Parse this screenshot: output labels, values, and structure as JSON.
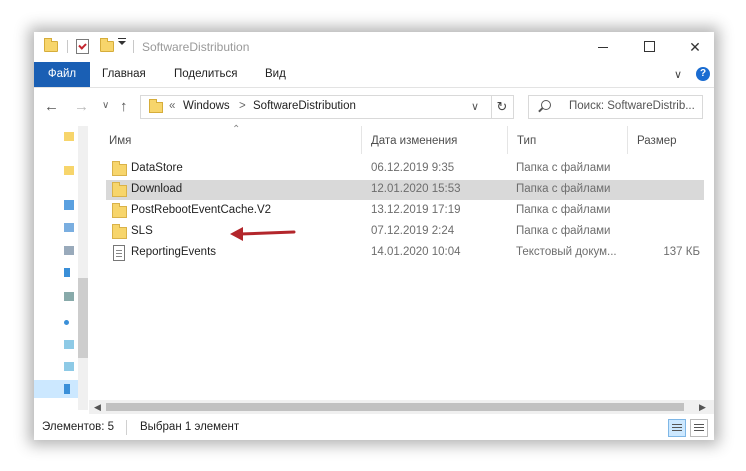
{
  "window": {
    "title": "SoftwareDistribution",
    "controls": {
      "minimize": "—",
      "maximize": "☐",
      "close": "✕"
    }
  },
  "ribbon": {
    "tabs": [
      {
        "label": "Файл"
      },
      {
        "label": "Главная"
      },
      {
        "label": "Поделиться"
      },
      {
        "label": "Вид"
      }
    ],
    "expand_glyph": "∨",
    "help_glyph": "?"
  },
  "address_bar": {
    "prefix": "«",
    "breadcrumbs": [
      "Windows",
      "SoftwareDistribution"
    ],
    "separator": ">",
    "search_placeholder": "Поиск: SoftwareDistrib..."
  },
  "columns": [
    "Имя",
    "Дата изменения",
    "Тип",
    "Размер"
  ],
  "files": [
    {
      "name": "DataStore",
      "date": "06.12.2019 9:35",
      "type": "Папка с файлами",
      "size": "",
      "icon": "folder-icon",
      "selected": false
    },
    {
      "name": "Download",
      "date": "12.01.2020 15:53",
      "type": "Папка с файлами",
      "size": "",
      "icon": "folder-icon",
      "selected": true
    },
    {
      "name": "PostRebootEventCache.V2",
      "date": "13.12.2019 17:19",
      "type": "Папка с файлами",
      "size": "",
      "icon": "folder-icon",
      "selected": false
    },
    {
      "name": "SLS",
      "date": "07.12.2019 2:24",
      "type": "Папка с файлами",
      "size": "",
      "icon": "folder-icon",
      "selected": false
    },
    {
      "name": "ReportingEvents",
      "date": "14.01.2020 10:04",
      "type": "Текстовый докум...",
      "size": "137 КБ",
      "icon": "text-file-icon",
      "selected": false
    }
  ],
  "status": {
    "items_count": "Элементов: 5",
    "selected": "Выбран 1 элемент"
  },
  "colors": {
    "accent": "#1a5fb4",
    "selection": "#d9d9d9",
    "annotation_arrow": "#b3262b",
    "folder": "#f7d56b"
  }
}
